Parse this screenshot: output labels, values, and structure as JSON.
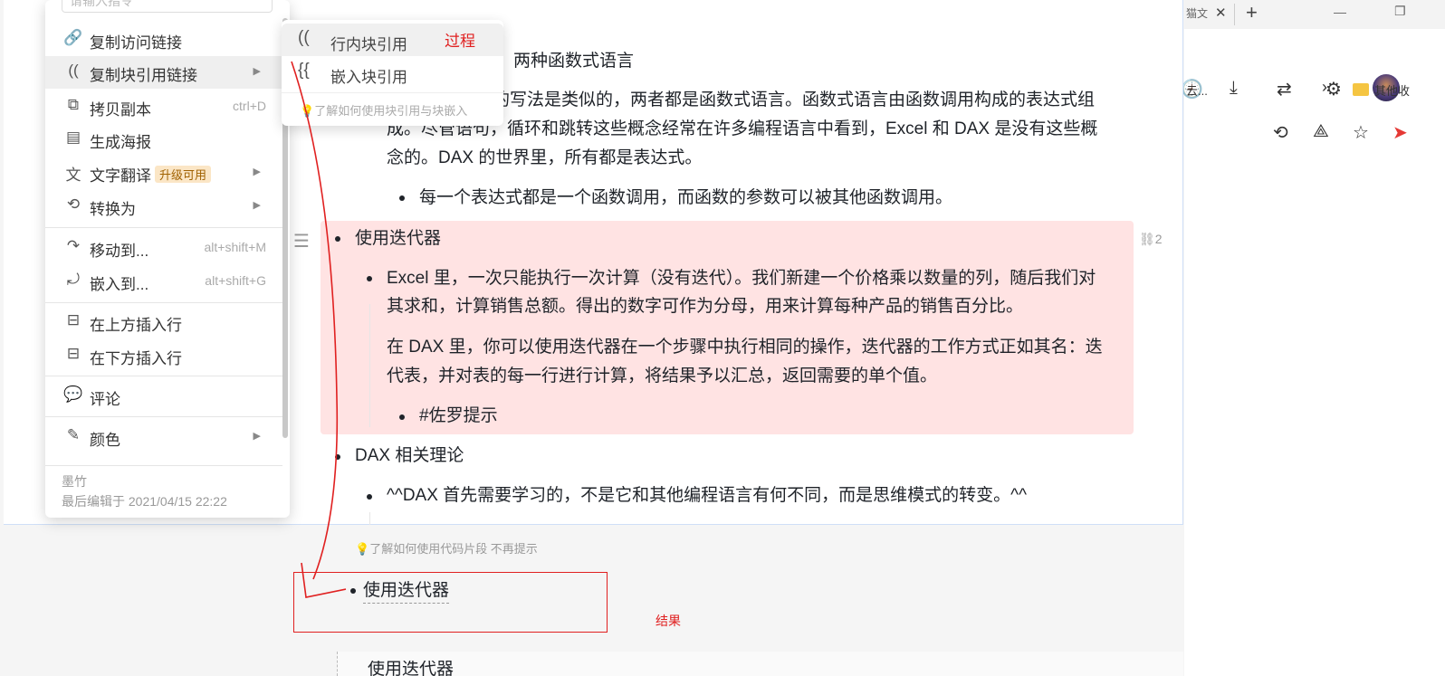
{
  "browser": {
    "tab_text_fragment": "猫文",
    "tab_close_glyph": "✕",
    "new_tab_glyph": "+",
    "bookmark_left_fragment": "云...",
    "bookmark_other": "其他收"
  },
  "document": {
    "heading_fragment": "两种函数式语言",
    "para1_line1": "的写法是类似的，两者都是函数式语言。函数式语言由函数调用构成的表达式组",
    "para1_line2": "成。尽管语句，循环和跳转这些概念经常在许多编程语言中看到，Excel 和 DAX 是没有这些概",
    "para1_line3": "念的。DAX 的世界里，所有都是表达式。",
    "bullet_expression": "每一个表达式都是一个函数调用，而函数的参数可以被其他函数调用。",
    "highlighted_block": {
      "title": "使用迭代器",
      "excel_line1": "Excel 里，一次只能执行一次计算（没有迭代）。我们新建一个价格乘以数量的列，随后我们对",
      "excel_line2": "其求和，计算销售总额。得出的数字可作为分母，用来计算每种产品的销售百分比。",
      "dax_line1": "在 DAX 里，你可以使用迭代器在一个步骤中执行相同的操作，迭代器的工作方式正如其名：迭",
      "dax_line2": "代表，并对表的每一行进行计算，将结果予以汇总，返回需要的单个值。",
      "tag": "#佐罗提示",
      "ref_count": "2"
    },
    "dax_theory": "DAX 相关理论",
    "dax_theory_sub": "^^DAX 首先需要学习的，不是它和其他编程语言有何不同，而是思维模式的转变。^^"
  },
  "context_menu": {
    "search_placeholder": "请输入指令",
    "items": [
      {
        "icon": "link-icon",
        "label": "复制访问链接",
        "shortcut": ""
      },
      {
        "icon": "block-ref-icon",
        "label": "复制块引用链接",
        "shortcut": "",
        "submenu": true
      },
      {
        "icon": "copy-icon",
        "label": "拷贝副本",
        "shortcut": "ctrl+D"
      },
      {
        "icon": "poster-icon",
        "label": "生成海报",
        "shortcut": ""
      },
      {
        "icon": "translate-icon",
        "label": "文字翻译",
        "badge": "升级可用",
        "submenu": true
      },
      {
        "icon": "convert-icon",
        "label": "转换为",
        "submenu": true
      },
      {
        "icon": "move-icon",
        "label": "移动到...",
        "shortcut": "alt+shift+M"
      },
      {
        "icon": "embed-icon",
        "label": "嵌入到...",
        "shortcut": "alt+shift+G"
      },
      {
        "icon": "insert-above-icon",
        "label": "在上方插入行",
        "shortcut": ""
      },
      {
        "icon": "insert-below-icon",
        "label": "在下方插入行",
        "shortcut": ""
      },
      {
        "icon": "comment-icon",
        "label": "评论",
        "shortcut": ""
      },
      {
        "icon": "color-icon",
        "label": "颜色",
        "submenu": true
      }
    ],
    "author": "墨竹",
    "last_edited": "最后编辑于 2021/04/15 22:22"
  },
  "submenu": {
    "items": [
      {
        "icon_glyph": "((",
        "label": "行内块引用"
      },
      {
        "icon_glyph": "{{",
        "label": "嵌入块引用"
      }
    ],
    "hint": "了解如何使用块引用与块嵌入"
  },
  "below": {
    "tip": "了解如何使用代码片段  不再提示",
    "result_item": "使用迭代器",
    "bottom_fragment": "使用迭代器"
  },
  "annotations": {
    "process_label": "过程",
    "result_label": "结果",
    "color": "#e02020"
  },
  "colors": {
    "highlight_bg": "#ffe3e3",
    "text": "#1f2329",
    "annotation_red": "#e02020"
  }
}
